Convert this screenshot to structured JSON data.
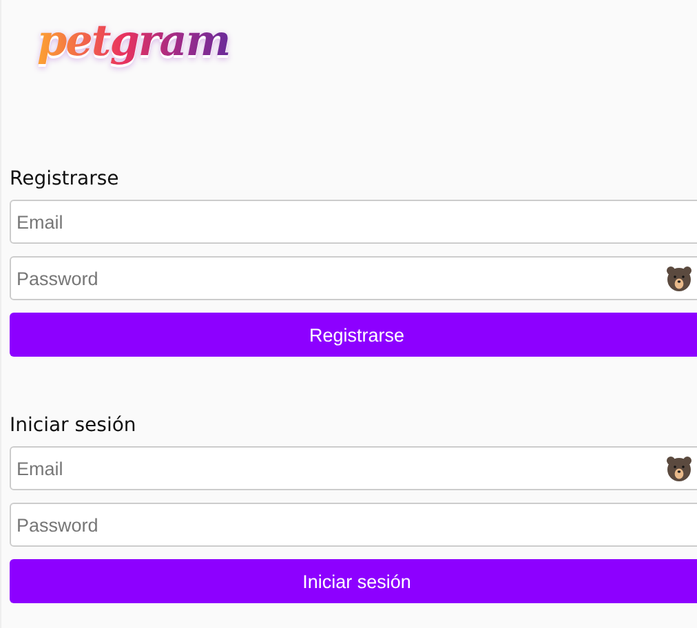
{
  "logo": {
    "text": "petgram"
  },
  "forms": [
    {
      "title": "Registrarse",
      "fields": [
        {
          "placeholder": "Email",
          "extension_icon": false
        },
        {
          "placeholder": "Password",
          "extension_icon": true
        }
      ],
      "button": "Registrarse"
    },
    {
      "title": "Iniciar sesión",
      "fields": [
        {
          "placeholder": "Email",
          "extension_icon": true
        },
        {
          "placeholder": "Password",
          "extension_icon": false
        }
      ],
      "button": "Iniciar sesión"
    }
  ]
}
